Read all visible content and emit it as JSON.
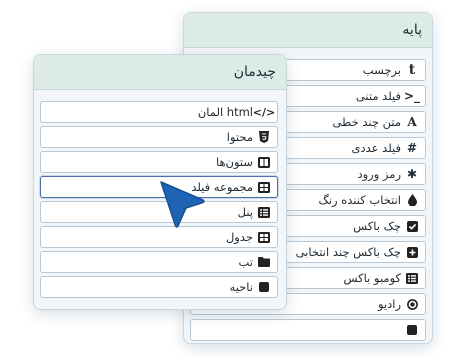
{
  "back_panel": {
    "title": "پایه",
    "items": [
      {
        "label": "برچسب",
        "icon": "t-icon"
      },
      {
        "label": "فیلد متنی",
        "icon": "terminal-icon"
      },
      {
        "label": "متن چند خطی",
        "icon": "font-a-icon"
      },
      {
        "label": "فیلد عددی",
        "icon": "hash-icon"
      },
      {
        "label": "رمز ورود",
        "icon": "asterisk-icon"
      },
      {
        "label": "انتخاب کننده رنگ",
        "icon": "droplet-icon"
      },
      {
        "label": "چک باکس",
        "icon": "checkbox-icon"
      },
      {
        "label": "چک باکس چند انتخابی",
        "icon": "plus-square-icon"
      },
      {
        "label": "کومبو باکس",
        "icon": "list-icon"
      },
      {
        "label": "رادیو",
        "icon": "radio-icon"
      }
    ]
  },
  "front_panel": {
    "title": "چیدمان",
    "items": [
      {
        "label": "المان html",
        "icon": "code-icon"
      },
      {
        "label": "محتوا",
        "icon": "html5-icon"
      },
      {
        "label": "ستون‌ها",
        "icon": "columns-icon"
      },
      {
        "label": "مجموعه فیلد",
        "icon": "table-icon",
        "selected": true
      },
      {
        "label": "پنل",
        "icon": "panel-list-icon"
      },
      {
        "label": "جدول",
        "icon": "table-icon"
      },
      {
        "label": "تب",
        "icon": "folder-icon"
      },
      {
        "label": "ناحیه",
        "icon": "square-icon"
      }
    ]
  }
}
